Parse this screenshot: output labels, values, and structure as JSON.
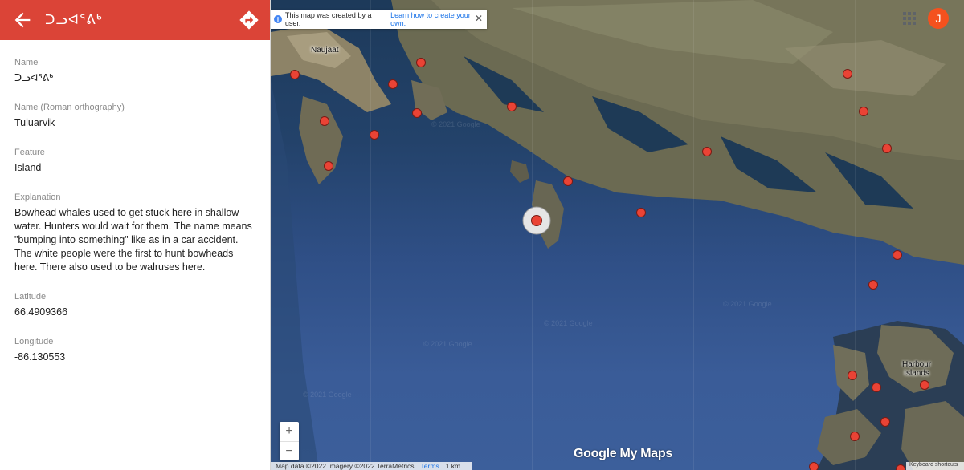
{
  "header": {
    "title": "ᑐᓗᐊᕐᕕᒃ",
    "back_icon": "arrow-left-icon",
    "directions_icon": "directions-icon",
    "color": "#db4437"
  },
  "fields": [
    {
      "label": "Name",
      "value": "ᑐᓗᐊᕐᕕᒃ"
    },
    {
      "label": "Name (Roman orthography)",
      "value": "Tuluarvik"
    },
    {
      "label": "Feature",
      "value": "Island"
    },
    {
      "label": "Explanation",
      "value": "Bowhead whales used to get stuck here in shallow water. Hunters would wait for them. The name means \"bumping into something\" like as in a car accident. The white people were the first to hunt bowheads here. There also used to be walruses here."
    },
    {
      "label": "Latitude",
      "value": "66.4909366"
    },
    {
      "label": "Longitude",
      "value": "-86.130553"
    }
  ],
  "map": {
    "banner_text": "This map was created by a user.",
    "banner_link": "Learn how to create your own.",
    "avatar_letter": "J",
    "zoom_in": "+",
    "zoom_out": "−",
    "logo_g": "Google",
    "logo_mm": " My Maps",
    "attribution": "Map data ©2022 Imagery ©2022 TerraMetrics",
    "terms": "Terms",
    "scale": "1 km",
    "keyboard": "Keyboard shortcuts",
    "watermark": "© 2021 Google",
    "labels": {
      "naujaat": "Naujaat",
      "harbour_islands": "Harbour\nIslands"
    },
    "marker_color": "#ea4335"
  }
}
